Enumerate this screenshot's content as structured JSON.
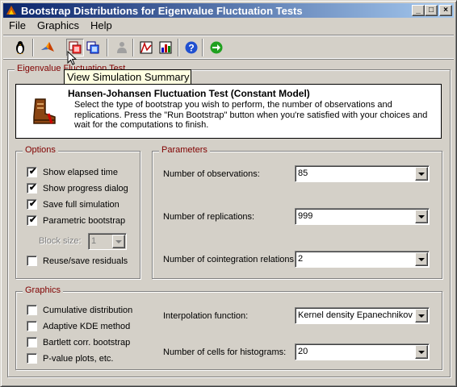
{
  "window": {
    "title": "Bootstrap Distributions for Eigenvalue Fluctuation Tests",
    "min_glyph": "_",
    "max_glyph": "□",
    "close_glyph": "×"
  },
  "menu": [
    "File",
    "Graphics",
    "Help"
  ],
  "toolbar": {
    "tooltip": "View Simulation Summary",
    "buttons": [
      "penguin-icon",
      "matlab-icon",
      "simulation-summary-icon",
      "copy-icon",
      "disabled-user-icon",
      "plot-icon",
      "chart-icon",
      "help-icon",
      "run-icon"
    ]
  },
  "main_group": {
    "legend": "Eigenvalue Fluctuation Test"
  },
  "header": {
    "title": "Hansen-Johansen Fluctuation Test (Constant Model)",
    "description": "Select the type of bootstrap you wish to perform, the number of observations and replications. Press the \"Run Bootstrap\" button when you're satisfied with your choices and wait for the computations to finish."
  },
  "options": {
    "legend": "Options",
    "items": [
      {
        "label": "Show elapsed time",
        "checked": true
      },
      {
        "label": "Show progress dialog",
        "checked": true
      },
      {
        "label": "Save full simulation",
        "checked": true
      },
      {
        "label": "Parametric bootstrap",
        "checked": true
      }
    ],
    "block_size_label": "Block size:",
    "block_size_value": "1",
    "reuse": {
      "label": "Reuse/save residuals",
      "checked": false
    }
  },
  "parameters": {
    "legend": "Parameters",
    "fields": [
      {
        "label": "Number of observations:",
        "value": "85"
      },
      {
        "label": "Number of replications:",
        "value": "999"
      },
      {
        "label": "Number of cointegration relations:",
        "value": "2"
      }
    ]
  },
  "graphics": {
    "legend": "Graphics",
    "items": [
      {
        "label": "Cumulative distribution",
        "checked": false
      },
      {
        "label": "Adaptive KDE method",
        "checked": false
      },
      {
        "label": "Bartlett corr. bootstrap",
        "checked": false
      },
      {
        "label": "P-value plots, etc.",
        "checked": false
      }
    ],
    "fields": [
      {
        "label": "Interpolation function:",
        "value": "Kernel density Epanechnikov"
      },
      {
        "label": "Number of cells for histograms:",
        "value": "20"
      }
    ]
  },
  "check_glyph": "✔"
}
